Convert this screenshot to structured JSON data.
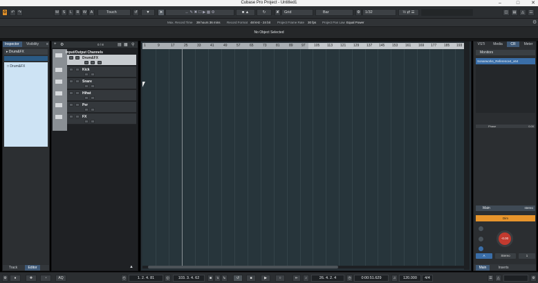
{
  "window": {
    "title": "Cubase Pro Project - Untitled1"
  },
  "toolbar": {
    "buttons": [
      "M",
      "S",
      "L",
      "R",
      "W",
      "A"
    ],
    "automation_mode": "Touch",
    "snap_type": "Grid",
    "grid_type": "Bar",
    "quantize": "1/32"
  },
  "infobar": {
    "max_record_time_label": "Max. Record Time",
    "max_record_time": "39 hours 36 mins",
    "record_format_label": "Record Format",
    "record_format": "48 kHz - 24 bit",
    "frame_rate_label": "Project Frame Rate",
    "frame_rate": "30 fps",
    "pan_law_label": "Project Pan Law",
    "pan_law": "Equal Power"
  },
  "status_line": "No Object Selected",
  "inspector": {
    "tabs": [
      "Inspector",
      "Visibility"
    ],
    "track_name": "Drum&FX",
    "list_item": "Drum&FX",
    "bottom_tabs": [
      "Track",
      "Editor"
    ]
  },
  "tracklist": {
    "counter": "0 / 8",
    "io_label": "Input/Output Channels",
    "tracks": [
      "Drum&FX",
      "Kick",
      "Snare",
      "Hihat",
      "Per",
      "FX"
    ]
  },
  "ruler": {
    "labels": [
      "1",
      "9",
      "17",
      "25",
      "33",
      "41",
      "49",
      "57",
      "65",
      "73",
      "81",
      "89",
      "97",
      "105",
      "113",
      "121",
      "129",
      "137",
      "145",
      "153",
      "161",
      "169",
      "177",
      "185",
      "193"
    ]
  },
  "rightzone": {
    "tabs": [
      "VSTi",
      "Media",
      "CR",
      "Meter"
    ],
    "monitors_label": "Monitors",
    "monitor_item": "Sonarworks_Reference4_x64",
    "phase_label": "Phase",
    "phase_value": "0.00",
    "main_label": "Main",
    "main_format": "stereo",
    "dim_label": "Dim",
    "knob_value": "-0.00",
    "stereo_label": "Stereo",
    "btn_a": "A",
    "btn_1": "1",
    "bottom_tabs": [
      "Main",
      "Inserts"
    ]
  },
  "transport": {
    "left_locator": "1. 2. 4. 81",
    "right_locator": "103. 3. 4. 62",
    "position_bars": "26. 4. 2. 4",
    "position_time": "0:00:51.629",
    "tempo": "120.000",
    "signature": "4/4",
    "aq_label": "AQ"
  },
  "colors": {
    "accent": "#e0902a",
    "selection": "#3a6ea8",
    "knob": "#c23a2f"
  }
}
